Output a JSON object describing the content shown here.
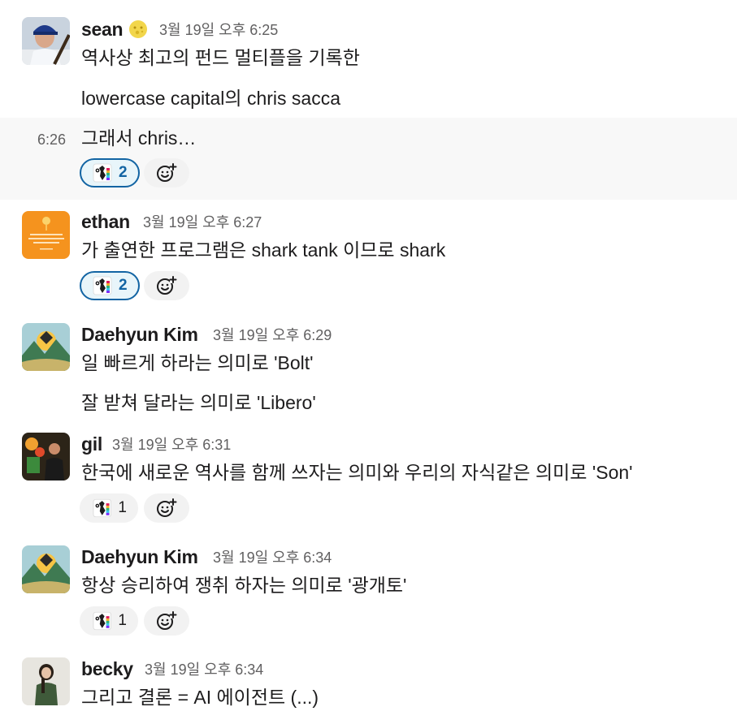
{
  "messages": [
    {
      "user": "sean",
      "status_emoji": "moon-face-emoji",
      "timestamp": "3월 19일 오후 6:25",
      "lines": [
        "역사상 최고의 펀드 멀티플을 기록한",
        "lowercase capital의 chris sacca"
      ]
    },
    {
      "continuation": true,
      "side_timestamp": "6:26",
      "text": "그래서 chris…",
      "reactions": [
        {
          "emoji": "parrot-emoji",
          "count": "2",
          "mine": true
        }
      ]
    },
    {
      "user": "ethan",
      "timestamp": "3월 19일 오후 6:27",
      "text": "가 출연한 프로그램은 shark tank 이므로 shark",
      "reactions": [
        {
          "emoji": "parrot-emoji",
          "count": "2",
          "mine": true
        }
      ]
    },
    {
      "user": "Daehyun Kim",
      "timestamp": "3월 19일 오후 6:29",
      "lines": [
        "일 빠르게 하라는 의미로 'Bolt'",
        "잘 받쳐 달라는 의미로 'Libero'"
      ]
    },
    {
      "user": "gil",
      "timestamp": "3월 19일 오후 6:31",
      "text": "한국에 새로운 역사를 함께 쓰자는 의미와 우리의 자식같은 의미로 'Son'",
      "reactions": [
        {
          "emoji": "parrot-emoji",
          "count": "1",
          "mine": false
        }
      ]
    },
    {
      "user": "Daehyun Kim",
      "timestamp": "3월 19일 오후 6:34",
      "text": "항상 승리하여 쟁취 하자는 의미로 '광개토'",
      "reactions": [
        {
          "emoji": "parrot-emoji",
          "count": "1",
          "mine": false
        }
      ]
    },
    {
      "user": "becky",
      "timestamp": "3월 19일 오후 6:34",
      "text": "그리고 결론 = AI 에이전트 (...)"
    }
  ],
  "colors": {
    "reaction_mine_bg": "#e8f5fa",
    "reaction_mine_border": "#1264a3",
    "hover_bg": "#f8f8f8",
    "timestamp": "#616061"
  }
}
